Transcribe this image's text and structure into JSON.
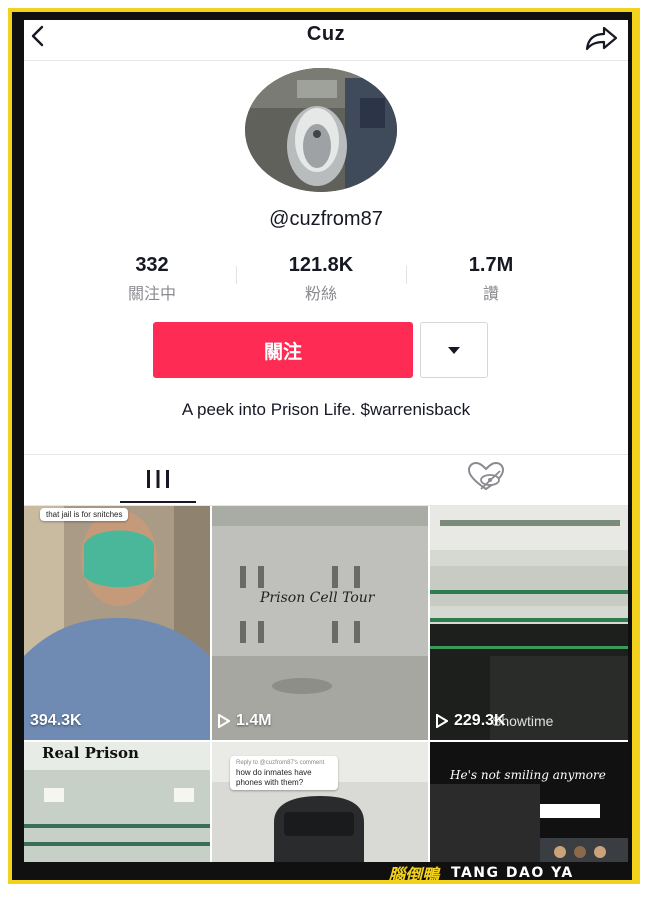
{
  "header": {
    "title": "Cuz",
    "back_icon": "back-chevron-icon",
    "share_icon": "share-arrow-icon"
  },
  "profile": {
    "handle": "@cuzfrom87",
    "stats": [
      {
        "value": "332",
        "label": "關注中"
      },
      {
        "value": "121.8K",
        "label": "粉絲"
      },
      {
        "value": "1.7M",
        "label": "讚"
      }
    ],
    "follow_label": "關注",
    "bio": "A peek into Prison Life. $warrenisback"
  },
  "tabs": [
    {
      "icon": "grid-icon",
      "active": true
    },
    {
      "icon": "liked-hidden-icon",
      "active": false
    }
  ],
  "videos": [
    {
      "views": "394.3K",
      "caption": "that jail is for snitches",
      "play_icon": false
    },
    {
      "views": "1.4M",
      "caption": "Prison Cell Tour",
      "play_icon": true
    },
    {
      "views": "229.3K",
      "caption": "Showtime",
      "play_icon": true
    },
    {
      "caption": "Real Prison"
    },
    {
      "caption": "how do inmates have phones with them?",
      "reply": "Reply to @cuzfrom87's comment"
    },
    {
      "caption": "He's not smiling anymore"
    }
  ],
  "watermark": {
    "chinese": "腦倒鴨",
    "english": "TANG DAO YA"
  },
  "colors": {
    "accent": "#fe2c55",
    "frame": "#f3d21d"
  }
}
